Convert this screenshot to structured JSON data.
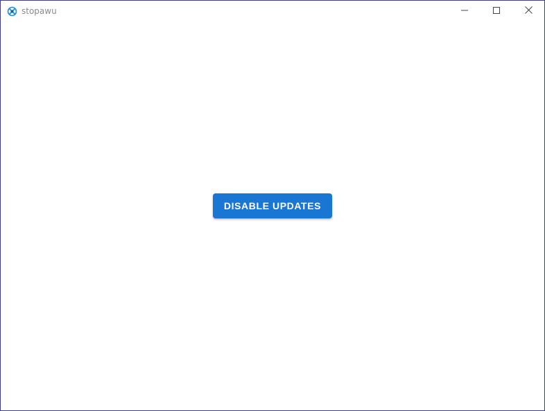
{
  "window": {
    "title": "stopawu",
    "icon": "stopawu-app-icon",
    "controls": {
      "minimize_icon": "minimize-icon",
      "maximize_icon": "maximize-icon",
      "close_icon": "close-icon"
    }
  },
  "main": {
    "action_button_label": "DISABLE UPDATES"
  },
  "colors": {
    "button_background": "#1976d2",
    "button_text": "#ffffff",
    "window_border": "#3b3f8c",
    "title_text": "#8a8a8a",
    "icon_accent": "#1f8fd6"
  }
}
